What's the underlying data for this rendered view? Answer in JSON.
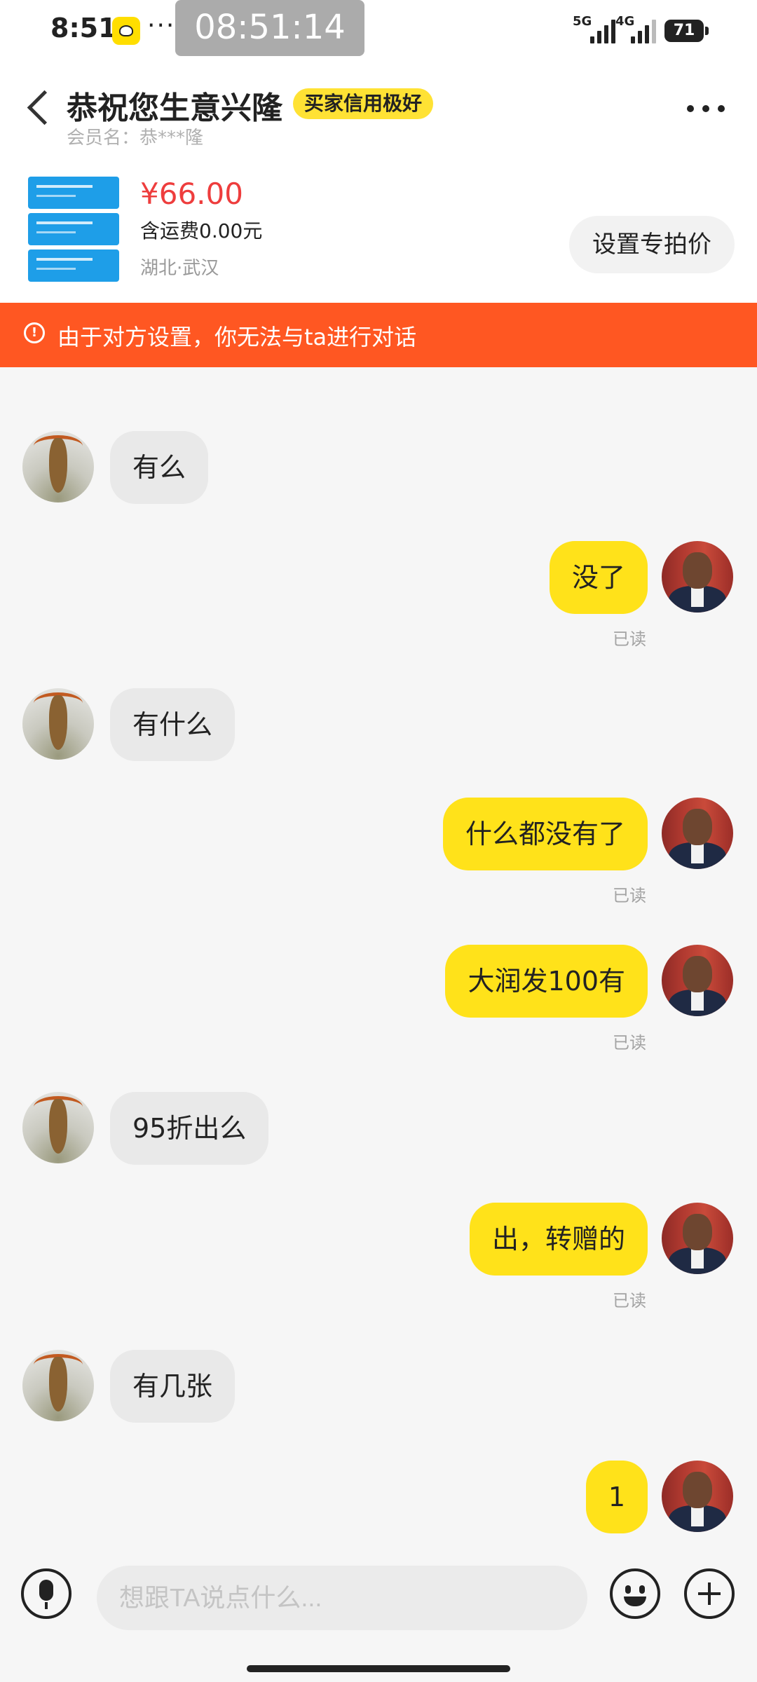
{
  "status_bar": {
    "time": "8:51",
    "overflow_dots": "···",
    "screen_clock": "08:51:14",
    "network_1": "5G",
    "network_2": "4G",
    "battery": "71"
  },
  "header": {
    "title": "恭祝您生意兴隆",
    "badge": "买家信用极好",
    "member": "会员名：恭***隆"
  },
  "product": {
    "price": "¥66.00",
    "shipping": "含运费0.00元",
    "location": "湖北·武汉",
    "set_price_label": "设置专拍价"
  },
  "banner": {
    "icon": "!",
    "text": "由于对方设置，你无法与ta进行对话"
  },
  "messages": [
    {
      "side": "in",
      "text": "有么"
    },
    {
      "side": "out",
      "text": "没了",
      "status": "已读"
    },
    {
      "side": "in",
      "text": "有什么"
    },
    {
      "side": "out",
      "text": "什么都没有了",
      "status": "已读"
    },
    {
      "side": "out",
      "text": "大润发100有",
      "status": "已读"
    },
    {
      "side": "in",
      "text": "95折出么"
    },
    {
      "side": "out",
      "text": "出，转赠的",
      "status": "已读"
    },
    {
      "side": "in",
      "text": "有几张"
    },
    {
      "side": "out",
      "text": "1"
    }
  ],
  "input": {
    "placeholder": "想跟TA说点什么..."
  },
  "icons": {
    "back": "chevron-left-icon",
    "more": "more-icon",
    "mic": "microphone-icon",
    "emoji": "emoji-icon",
    "plus": "plus-icon",
    "warning": "warning-icon"
  },
  "colors": {
    "banner": "#ff5722",
    "price": "#ee3d3d",
    "outgoing_bubble": "#ffe21a",
    "incoming_bubble": "#e9e9e9",
    "badge": "#ffe234"
  }
}
